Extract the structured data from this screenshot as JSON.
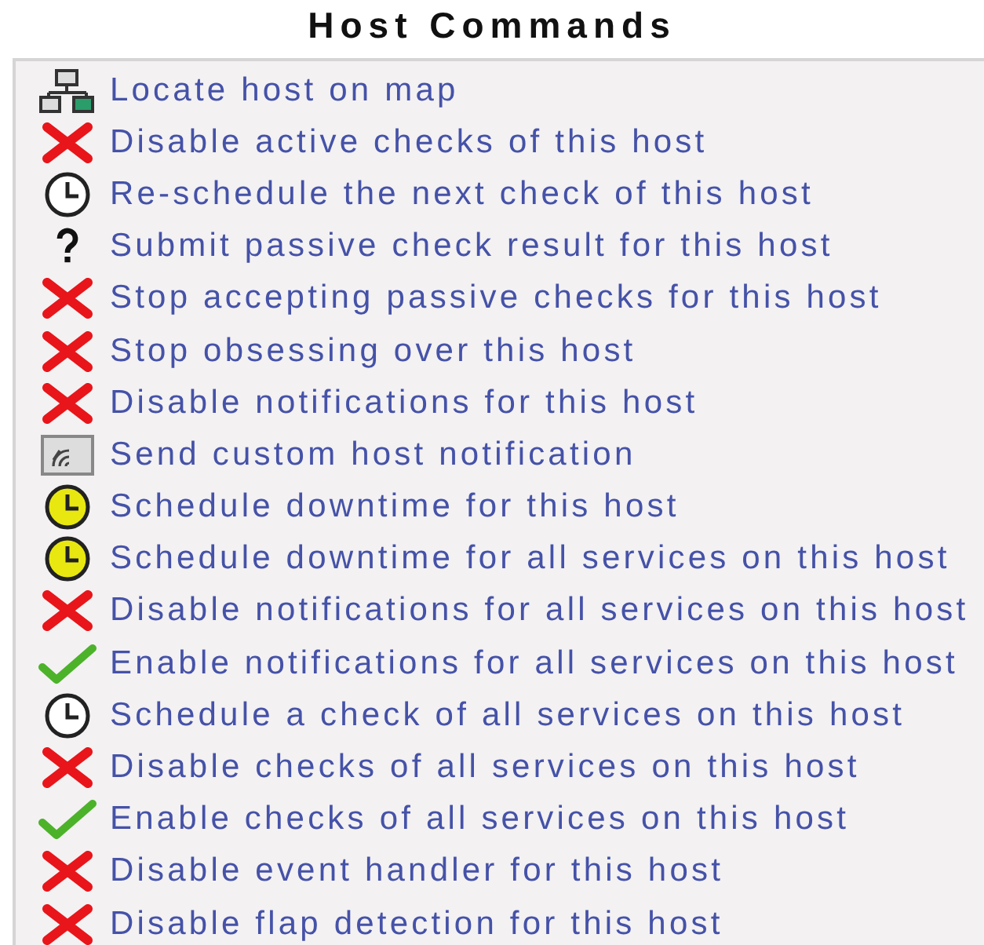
{
  "title": "Host Commands",
  "commands": [
    {
      "kind": "map",
      "label": "Locate host on map"
    },
    {
      "kind": "disable",
      "label": "Disable active checks of this host"
    },
    {
      "kind": "clock",
      "label": "Re-schedule the next check of this host"
    },
    {
      "kind": "question",
      "label": "Submit passive check result for this host"
    },
    {
      "kind": "disable",
      "label": "Stop accepting passive checks for this host"
    },
    {
      "kind": "disable",
      "label": "Stop obsessing over this host"
    },
    {
      "kind": "disable",
      "label": "Disable notifications for this host"
    },
    {
      "kind": "notify",
      "label": "Send custom host notification"
    },
    {
      "kind": "downtime",
      "label": "Schedule downtime for this host"
    },
    {
      "kind": "downtime",
      "label": "Schedule downtime for all services on this host"
    },
    {
      "kind": "disable",
      "label": "Disable notifications for all services on this host"
    },
    {
      "kind": "enable",
      "label": "Enable notifications for all services on this host"
    },
    {
      "kind": "clock",
      "label": "Schedule a check of all services on this host"
    },
    {
      "kind": "disable",
      "label": "Disable checks of all services on this host"
    },
    {
      "kind": "enable",
      "label": "Enable checks of all services on this host"
    },
    {
      "kind": "disable",
      "label": "Disable event handler for this host"
    },
    {
      "kind": "disable",
      "label": "Disable flap detection for this host"
    }
  ]
}
